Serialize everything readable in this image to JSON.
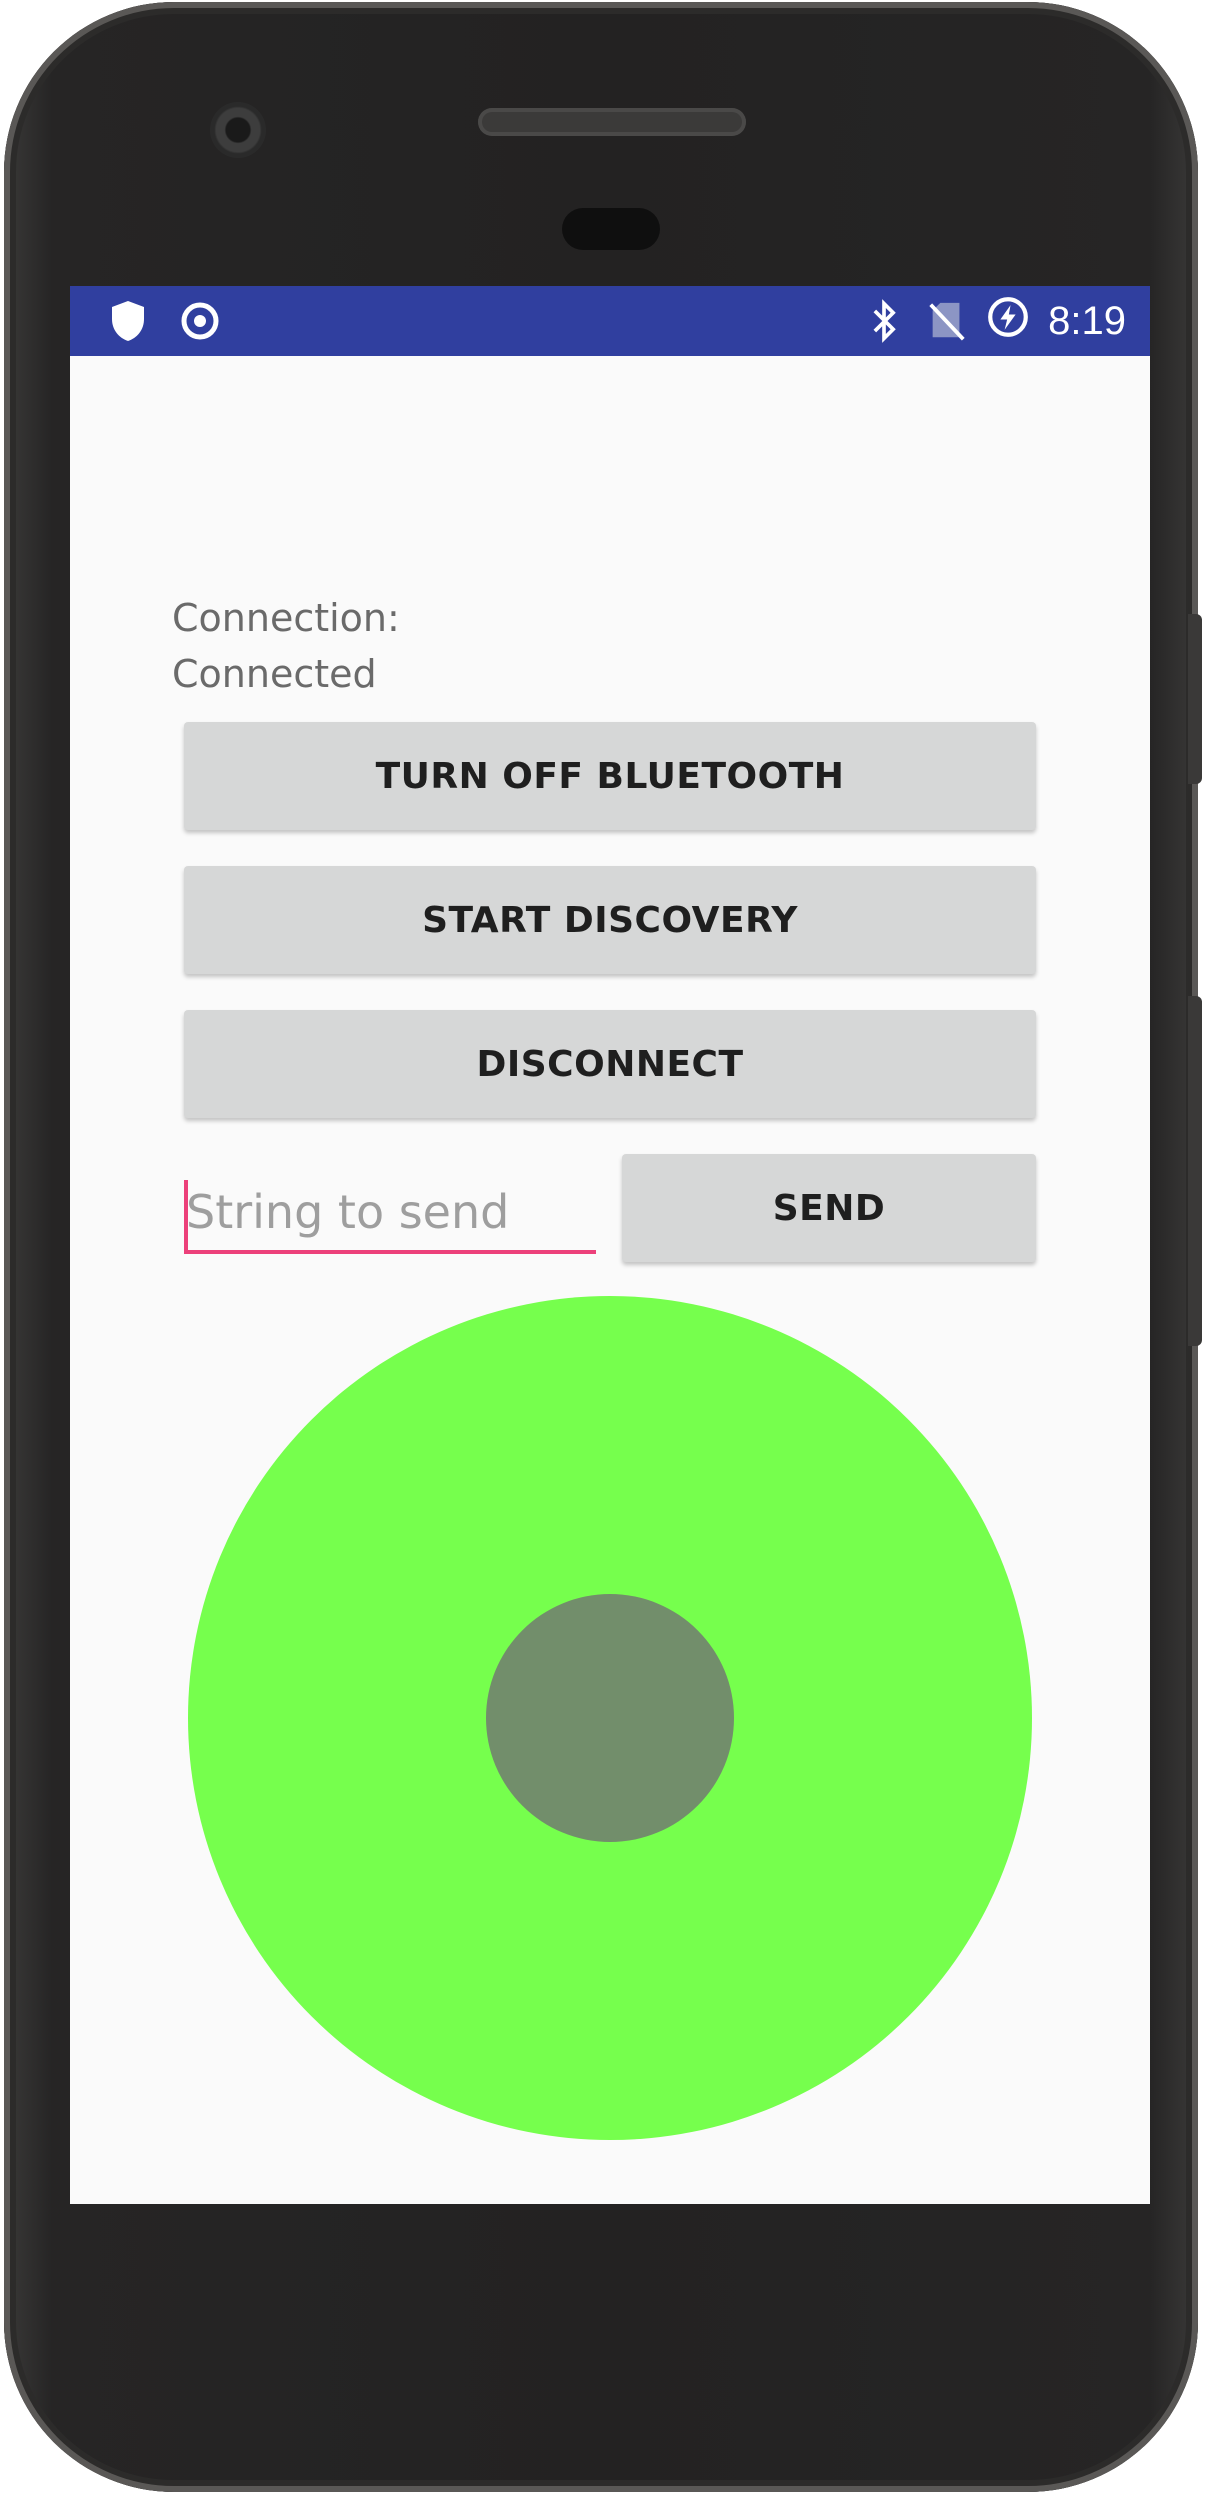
{
  "status_bar": {
    "time": "8:19",
    "left_icons": [
      "shield-icon",
      "target-icon"
    ],
    "right_icons": [
      "bluetooth-icon",
      "no-sim-icon",
      "battery-charging-icon"
    ],
    "background_color": "#303f9f"
  },
  "connection": {
    "label": "Connection:",
    "status": "Connected"
  },
  "buttons": {
    "bluetooth": "TURN OFF BLUETOOTH",
    "discovery": "START DISCOVERY",
    "disconnect": "DISCONNECT",
    "send": "SEND"
  },
  "message_input": {
    "placeholder": "String to send",
    "value": "",
    "accent_color": "#ec407a"
  },
  "joystick": {
    "base_color": "#76ff4d",
    "knob_color": "#728e6b"
  }
}
